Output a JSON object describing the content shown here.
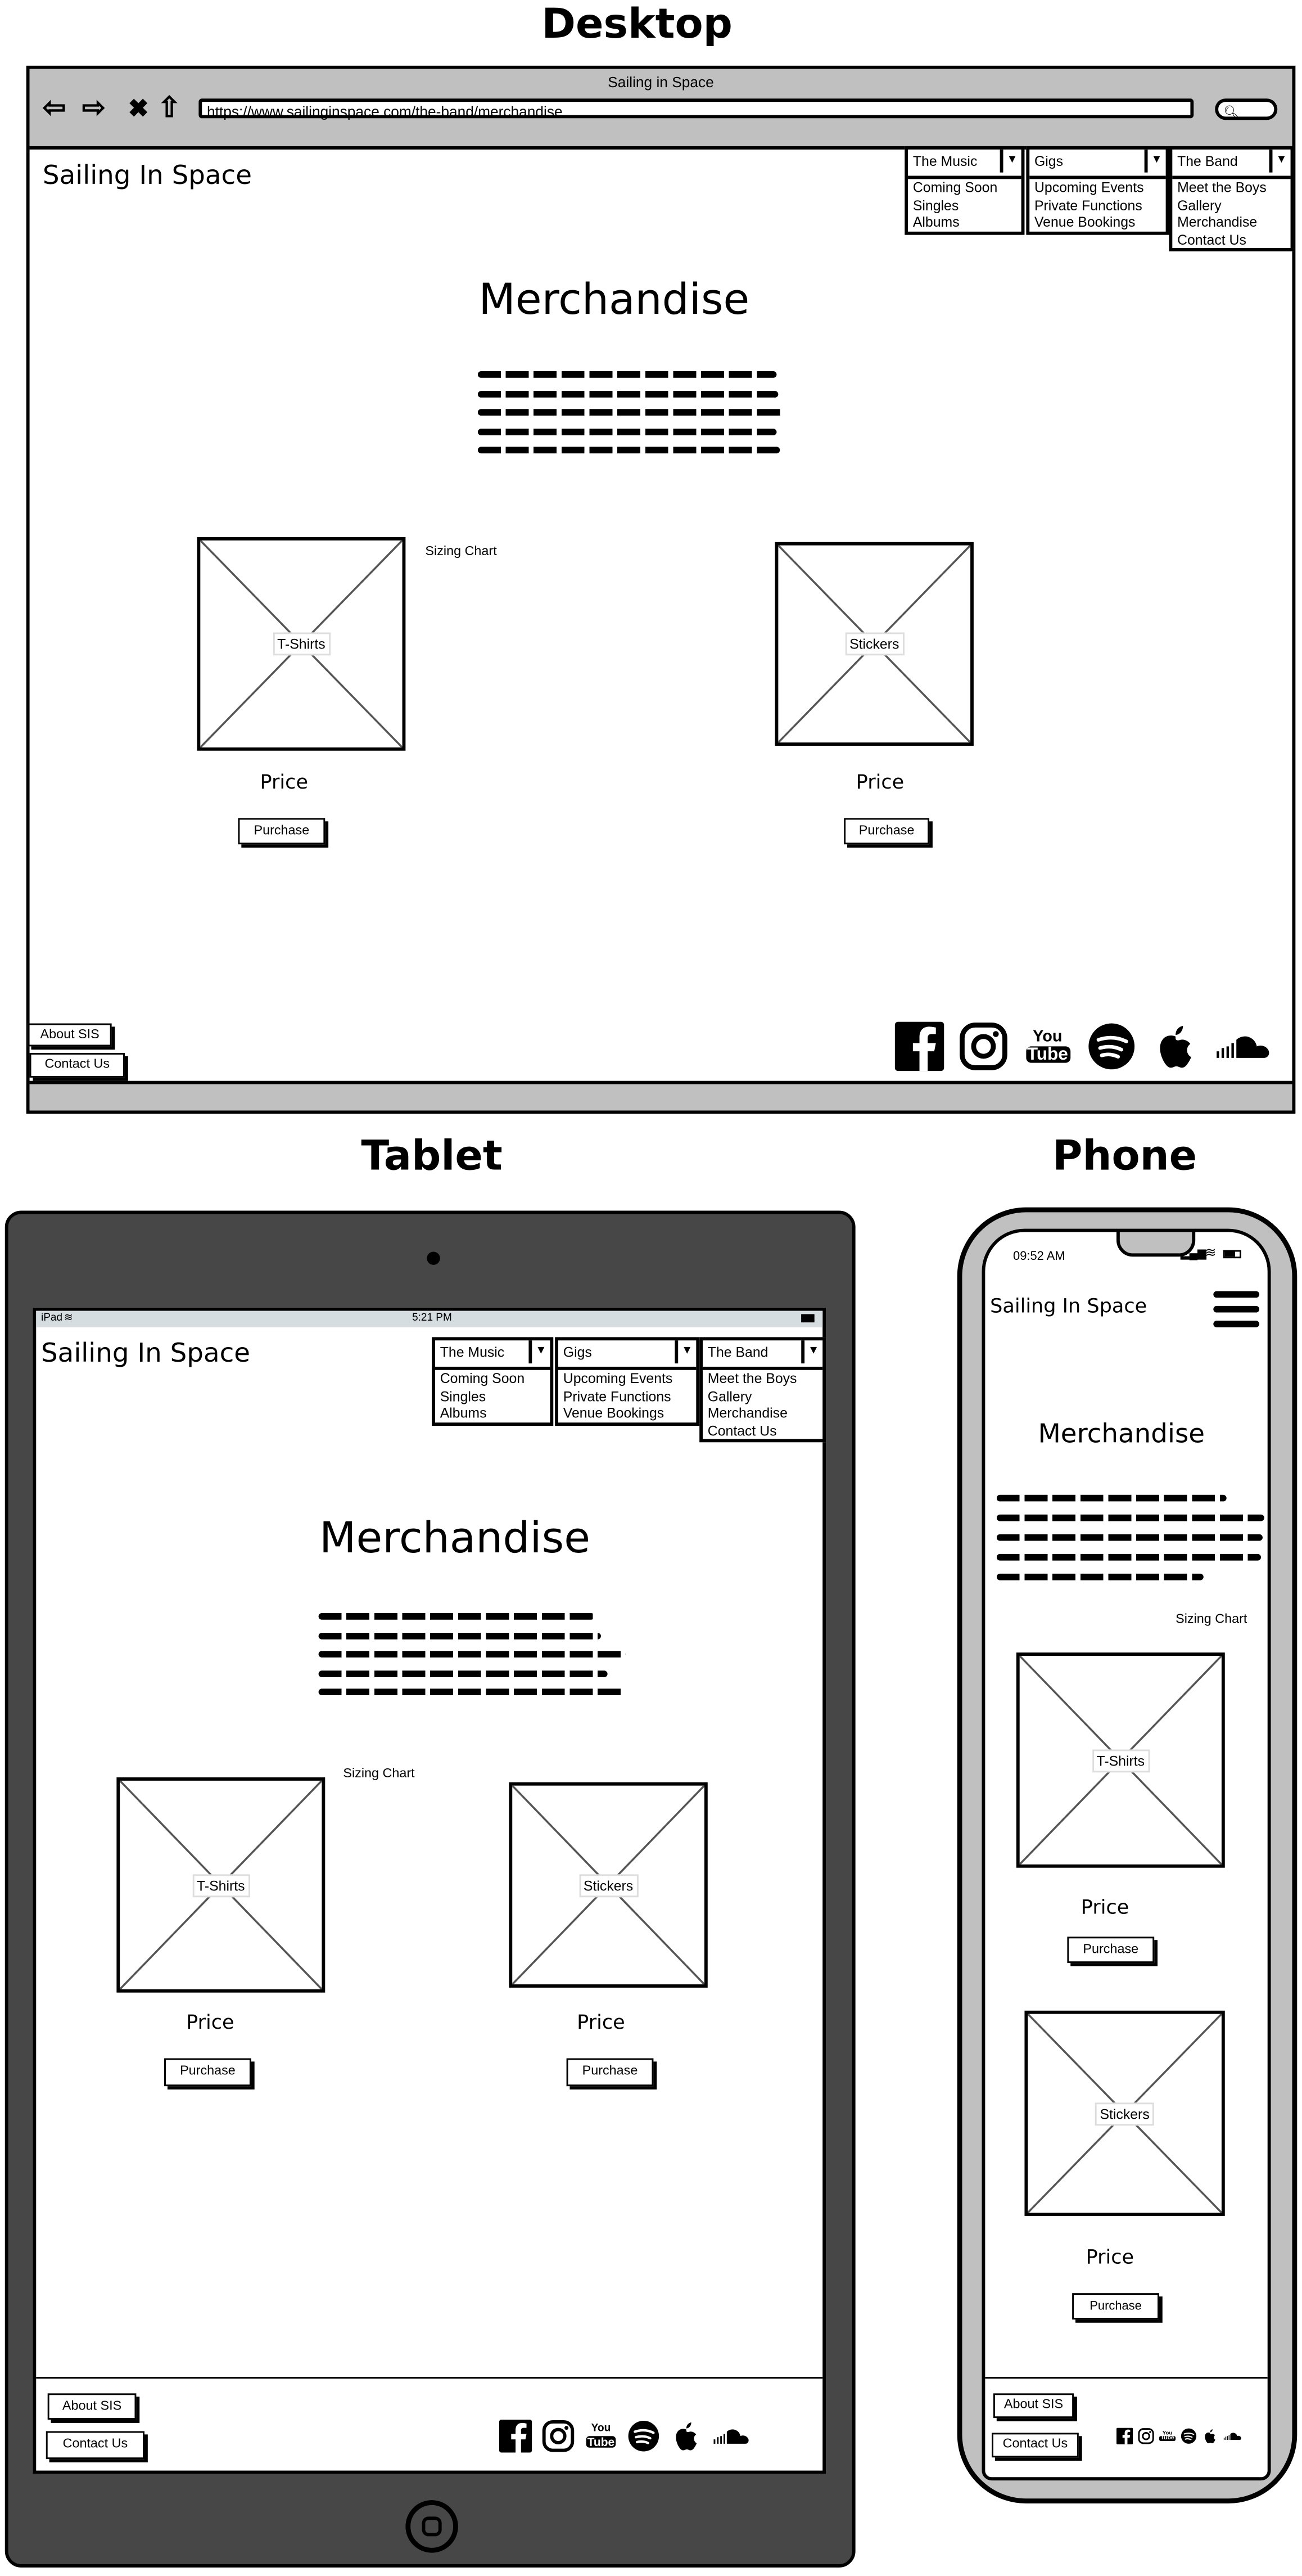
{
  "titles": {
    "desktop": "Desktop",
    "tablet": "Tablet",
    "phone": "Phone"
  },
  "browser": {
    "window_title": "Sailing in Space",
    "url": "https://www.sailinginspace.com/the-band/merchandise"
  },
  "site": {
    "logo": "Sailing In Space",
    "heading": "Merchandise",
    "sizing_chart": "Sizing Chart",
    "price_label": "Price",
    "purchase_label": "Purchase",
    "products": [
      "T-Shirts",
      "Stickers"
    ],
    "footer": {
      "about": "About SIS",
      "contact": "Contact Us"
    },
    "social_icons": [
      "facebook-icon",
      "instagram-icon",
      "youtube-icon",
      "spotify-icon",
      "apple-icon",
      "soundcloud-icon"
    ],
    "youtube_text": [
      "You",
      "Tube"
    ]
  },
  "nav": [
    {
      "label": "The Music",
      "items": [
        "Coming Soon",
        "Singles",
        "Albums"
      ]
    },
    {
      "label": "Gigs",
      "items": [
        "Upcoming Events",
        "Private Functions",
        "Venue Bookings"
      ]
    },
    {
      "label": "The Band",
      "items": [
        "Meet the Boys",
        "Gallery",
        "Merchandise",
        "Contact Us"
      ]
    }
  ],
  "tablet_status": {
    "device": "iPad",
    "time": "5:21 PM"
  },
  "phone_status": {
    "time": "09:52 AM"
  }
}
